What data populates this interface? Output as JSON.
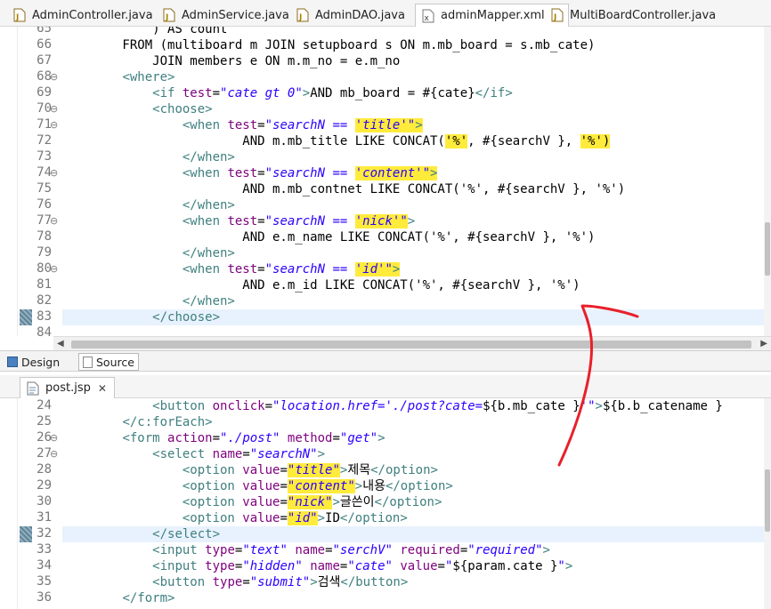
{
  "top_tabs": [
    {
      "label": "AdminController.java",
      "icon": "java-file-icon"
    },
    {
      "label": "AdminService.java",
      "icon": "java-file-icon"
    },
    {
      "label": "AdminDAO.java",
      "icon": "java-file-icon"
    },
    {
      "label": "adminMapper.xml",
      "icon": "xml-file-icon",
      "close": "✕"
    },
    {
      "label": "MultiBoardController.java",
      "icon": "java-file-icon"
    }
  ],
  "editor1": {
    "lines": [
      {
        "n": "65",
        "fold": "",
        "parts": [
          {
            "t": "plain",
            "s": "            ) AS count"
          }
        ]
      },
      {
        "n": "66",
        "fold": "",
        "parts": [
          {
            "t": "plain",
            "s": "        FROM (multiboard m JOIN setupboard s ON m.mb_board = s.mb_cate)"
          }
        ]
      },
      {
        "n": "67",
        "fold": "",
        "parts": [
          {
            "t": "plain",
            "s": "            JOIN members e ON m.m_no = e.m_no"
          }
        ]
      },
      {
        "n": "68",
        "fold": "⊖",
        "parts": [
          {
            "t": "plain",
            "s": "        "
          },
          {
            "t": "tag",
            "s": "<where>"
          }
        ]
      },
      {
        "n": "69",
        "fold": "",
        "parts": [
          {
            "t": "plain",
            "s": "            "
          },
          {
            "t": "tag",
            "s": "<if "
          },
          {
            "t": "attr",
            "s": "test"
          },
          {
            "t": "plain",
            "s": "="
          },
          {
            "t": "val",
            "s": "\"cate gt 0\""
          },
          {
            "t": "tag",
            "s": ">"
          },
          {
            "t": "plain",
            "s": "AND mb_board = #{cate}"
          },
          {
            "t": "tag",
            "s": "</if>"
          }
        ]
      },
      {
        "n": "70",
        "fold": "⊖",
        "parts": [
          {
            "t": "plain",
            "s": "            "
          },
          {
            "t": "tag",
            "s": "<choose>"
          }
        ]
      },
      {
        "n": "71",
        "fold": "⊖",
        "parts": [
          {
            "t": "plain",
            "s": "                "
          },
          {
            "t": "tag",
            "s": "<when "
          },
          {
            "t": "attr",
            "s": "test"
          },
          {
            "t": "plain",
            "s": "="
          },
          {
            "t": "val",
            "s": "\"searchN == "
          },
          {
            "t": "val hl",
            "s": "'title'\""
          },
          {
            "t": "tag hl",
            "s": ">"
          }
        ]
      },
      {
        "n": "72",
        "fold": "",
        "parts": [
          {
            "t": "plain",
            "s": "                        AND m.mb_title LIKE CONCAT("
          },
          {
            "t": "plain hl",
            "s": "'%'"
          },
          {
            "t": "plain",
            "s": ", #{searchV }, "
          },
          {
            "t": "plain hl",
            "s": "'%')"
          }
        ]
      },
      {
        "n": "73",
        "fold": "",
        "parts": [
          {
            "t": "plain",
            "s": "                "
          },
          {
            "t": "tag",
            "s": "</when>"
          }
        ]
      },
      {
        "n": "74",
        "fold": "⊖",
        "parts": [
          {
            "t": "plain",
            "s": "                "
          },
          {
            "t": "tag",
            "s": "<when "
          },
          {
            "t": "attr",
            "s": "test"
          },
          {
            "t": "plain",
            "s": "="
          },
          {
            "t": "val",
            "s": "\"searchN == "
          },
          {
            "t": "val hl",
            "s": "'content'\""
          },
          {
            "t": "tag hl",
            "s": ">"
          }
        ]
      },
      {
        "n": "75",
        "fold": "",
        "parts": [
          {
            "t": "plain",
            "s": "                        AND m.mb_contnet LIKE CONCAT('%', #{searchV }, '%')"
          }
        ]
      },
      {
        "n": "76",
        "fold": "",
        "parts": [
          {
            "t": "plain",
            "s": "                "
          },
          {
            "t": "tag",
            "s": "</when>"
          }
        ]
      },
      {
        "n": "77",
        "fold": "⊖",
        "parts": [
          {
            "t": "plain",
            "s": "                "
          },
          {
            "t": "tag",
            "s": "<when "
          },
          {
            "t": "attr",
            "s": "test"
          },
          {
            "t": "plain",
            "s": "="
          },
          {
            "t": "val",
            "s": "\"searchN == "
          },
          {
            "t": "val hl",
            "s": "'nick'\""
          },
          {
            "t": "tag",
            "s": ">"
          }
        ]
      },
      {
        "n": "78",
        "fold": "",
        "parts": [
          {
            "t": "plain",
            "s": "                        AND e.m_name LIKE CONCAT('%', #{searchV }, '%')"
          }
        ]
      },
      {
        "n": "79",
        "fold": "",
        "parts": [
          {
            "t": "plain",
            "s": "                "
          },
          {
            "t": "tag",
            "s": "</when>"
          }
        ]
      },
      {
        "n": "80",
        "fold": "⊖",
        "parts": [
          {
            "t": "plain",
            "s": "                "
          },
          {
            "t": "tag",
            "s": "<when "
          },
          {
            "t": "attr",
            "s": "test"
          },
          {
            "t": "plain",
            "s": "="
          },
          {
            "t": "val",
            "s": "\"searchN == "
          },
          {
            "t": "val hl",
            "s": "'id'\""
          },
          {
            "t": "tag hl",
            "s": ">"
          }
        ]
      },
      {
        "n": "81",
        "fold": "",
        "parts": [
          {
            "t": "plain",
            "s": "                        AND e.m_id LIKE CONCAT('%', #{searchV }, '%')"
          }
        ]
      },
      {
        "n": "82",
        "fold": "",
        "parts": [
          {
            "t": "plain",
            "s": "                "
          },
          {
            "t": "tag",
            "s": "</when>"
          }
        ]
      },
      {
        "n": "83",
        "fold": "",
        "current": true,
        "parts": [
          {
            "t": "plain",
            "s": "            "
          },
          {
            "t": "tag",
            "s": "</choose>"
          }
        ]
      },
      {
        "n": "84",
        "fold": "",
        "parts": []
      }
    ]
  },
  "design_tabs": [
    {
      "label": "Design",
      "icon": "design-icon"
    },
    {
      "label": "Source",
      "icon": "source-icon"
    }
  ],
  "bottom_tab": {
    "label": "post.jsp",
    "icon": "jsp-file-icon",
    "close": "✕"
  },
  "editor2": {
    "lines": [
      {
        "n": "24",
        "fold": "",
        "parts": [
          {
            "t": "plain",
            "s": "            "
          },
          {
            "t": "tag",
            "s": "<button "
          },
          {
            "t": "attr",
            "s": "onclick"
          },
          {
            "t": "plain",
            "s": "="
          },
          {
            "t": "val",
            "s": "\"location.href='./post?cate="
          },
          {
            "t": "plain",
            "s": "${b.mb_cate }"
          },
          {
            "t": "val",
            "s": "'\""
          },
          {
            "t": "tag",
            "s": ">"
          },
          {
            "t": "plain",
            "s": "${b.b_catename }"
          }
        ]
      },
      {
        "n": "25",
        "fold": "",
        "parts": [
          {
            "t": "plain",
            "s": "        "
          },
          {
            "t": "tag",
            "s": "</c:forEach>"
          }
        ]
      },
      {
        "n": "26",
        "fold": "⊖",
        "parts": [
          {
            "t": "plain",
            "s": "        "
          },
          {
            "t": "tag",
            "s": "<form "
          },
          {
            "t": "attr",
            "s": "action"
          },
          {
            "t": "plain",
            "s": "="
          },
          {
            "t": "val",
            "s": "\"./post\""
          },
          {
            "t": "plain",
            "s": " "
          },
          {
            "t": "attr",
            "s": "method"
          },
          {
            "t": "plain",
            "s": "="
          },
          {
            "t": "val",
            "s": "\"get\""
          },
          {
            "t": "tag",
            "s": ">"
          }
        ]
      },
      {
        "n": "27",
        "fold": "⊖",
        "parts": [
          {
            "t": "plain",
            "s": "            "
          },
          {
            "t": "tag",
            "s": "<select "
          },
          {
            "t": "attr",
            "s": "name"
          },
          {
            "t": "plain",
            "s": "="
          },
          {
            "t": "val",
            "s": "\"searchN\""
          },
          {
            "t": "tag",
            "s": ">"
          }
        ]
      },
      {
        "n": "28",
        "fold": "",
        "parts": [
          {
            "t": "plain",
            "s": "                "
          },
          {
            "t": "tag",
            "s": "<option "
          },
          {
            "t": "attr",
            "s": "value"
          },
          {
            "t": "plain",
            "s": "="
          },
          {
            "t": "val hl",
            "s": "\"title\""
          },
          {
            "t": "tag",
            "s": ">"
          },
          {
            "t": "plain",
            "s": "제목"
          },
          {
            "t": "tag",
            "s": "</option>"
          }
        ]
      },
      {
        "n": "29",
        "fold": "",
        "parts": [
          {
            "t": "plain",
            "s": "                "
          },
          {
            "t": "tag",
            "s": "<option "
          },
          {
            "t": "attr",
            "s": "value"
          },
          {
            "t": "plain",
            "s": "="
          },
          {
            "t": "val hl",
            "s": "\"content\""
          },
          {
            "t": "tag",
            "s": ">"
          },
          {
            "t": "plain",
            "s": "내용"
          },
          {
            "t": "tag",
            "s": "</option>"
          }
        ]
      },
      {
        "n": "30",
        "fold": "",
        "parts": [
          {
            "t": "plain",
            "s": "                "
          },
          {
            "t": "tag",
            "s": "<option "
          },
          {
            "t": "attr",
            "s": "value"
          },
          {
            "t": "plain",
            "s": "="
          },
          {
            "t": "val hl",
            "s": "\"nick\""
          },
          {
            "t": "tag",
            "s": ">"
          },
          {
            "t": "plain",
            "s": "글쓴이"
          },
          {
            "t": "tag",
            "s": "</option>"
          }
        ]
      },
      {
        "n": "31",
        "fold": "",
        "parts": [
          {
            "t": "plain",
            "s": "                "
          },
          {
            "t": "tag",
            "s": "<option "
          },
          {
            "t": "attr",
            "s": "value"
          },
          {
            "t": "plain",
            "s": "="
          },
          {
            "t": "val hl",
            "s": "\"id\""
          },
          {
            "t": "tag",
            "s": ">"
          },
          {
            "t": "plain",
            "s": "ID"
          },
          {
            "t": "tag",
            "s": "</option>"
          }
        ]
      },
      {
        "n": "32",
        "fold": "",
        "current": true,
        "parts": [
          {
            "t": "plain",
            "s": "            "
          },
          {
            "t": "tag",
            "s": "</select>"
          }
        ]
      },
      {
        "n": "33",
        "fold": "",
        "parts": [
          {
            "t": "plain",
            "s": "            "
          },
          {
            "t": "tag",
            "s": "<input "
          },
          {
            "t": "attr",
            "s": "type"
          },
          {
            "t": "plain",
            "s": "="
          },
          {
            "t": "val",
            "s": "\"text\""
          },
          {
            "t": "plain",
            "s": " "
          },
          {
            "t": "attr",
            "s": "name"
          },
          {
            "t": "plain",
            "s": "="
          },
          {
            "t": "val",
            "s": "\"serchV\""
          },
          {
            "t": "plain",
            "s": " "
          },
          {
            "t": "attr",
            "s": "required"
          },
          {
            "t": "plain",
            "s": "="
          },
          {
            "t": "val",
            "s": "\"required\""
          },
          {
            "t": "tag",
            "s": ">"
          }
        ]
      },
      {
        "n": "34",
        "fold": "",
        "parts": [
          {
            "t": "plain",
            "s": "            "
          },
          {
            "t": "tag",
            "s": "<input "
          },
          {
            "t": "attr",
            "s": "type"
          },
          {
            "t": "plain",
            "s": "="
          },
          {
            "t": "val",
            "s": "\"hidden\""
          },
          {
            "t": "plain",
            "s": " "
          },
          {
            "t": "attr",
            "s": "name"
          },
          {
            "t": "plain",
            "s": "="
          },
          {
            "t": "val",
            "s": "\"cate\""
          },
          {
            "t": "plain",
            "s": " "
          },
          {
            "t": "attr",
            "s": "value"
          },
          {
            "t": "plain",
            "s": "="
          },
          {
            "t": "val",
            "s": "\""
          },
          {
            "t": "plain",
            "s": "${param.cate }"
          },
          {
            "t": "val",
            "s": "\""
          },
          {
            "t": "tag",
            "s": ">"
          }
        ]
      },
      {
        "n": "35",
        "fold": "",
        "parts": [
          {
            "t": "plain",
            "s": "            "
          },
          {
            "t": "tag",
            "s": "<button "
          },
          {
            "t": "attr",
            "s": "type"
          },
          {
            "t": "plain",
            "s": "="
          },
          {
            "t": "val",
            "s": "\"submit\""
          },
          {
            "t": "tag",
            "s": ">"
          },
          {
            "t": "plain",
            "s": "검색"
          },
          {
            "t": "tag",
            "s": "</button>"
          }
        ]
      },
      {
        "n": "36",
        "fold": "",
        "parts": [
          {
            "t": "plain",
            "s": "        "
          },
          {
            "t": "tag",
            "s": "</form>"
          }
        ]
      }
    ]
  },
  "annotation": {
    "color": "#e8202a",
    "kind": "hand-drawn-arrow"
  }
}
